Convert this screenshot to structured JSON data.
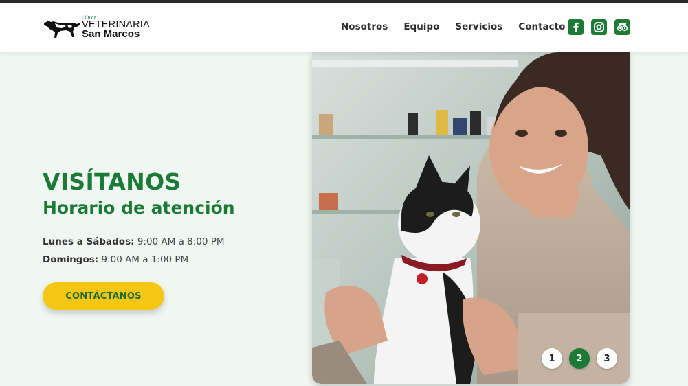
{
  "brand": {
    "small": "Clínica",
    "line1": "VETERINARIA",
    "line2": "San Marcos"
  },
  "nav": {
    "items": [
      {
        "label": "Nosotros"
      },
      {
        "label": "Equipo"
      },
      {
        "label": "Servicios"
      },
      {
        "label": "Contacto"
      }
    ]
  },
  "social": {
    "icons": [
      "facebook-icon",
      "instagram-icon",
      "tripadvisor-icon"
    ],
    "color": "#1e7a35"
  },
  "hero": {
    "title": "VISÍTANOS",
    "subtitle": "Horario de atención",
    "hours": [
      {
        "days": "Lunes a Sábados:",
        "time": "9:00 AM a 8:00 PM"
      },
      {
        "days": "Domingos:",
        "time": "9:00 AM a 1:00 PM"
      }
    ],
    "cta_label": "CONTÁCTANOS"
  },
  "carousel": {
    "pages": [
      "1",
      "2",
      "3"
    ],
    "active": "2"
  },
  "colors": {
    "accent": "#1a7a36",
    "cta": "#f6c615",
    "background": "#f0f7f2"
  }
}
